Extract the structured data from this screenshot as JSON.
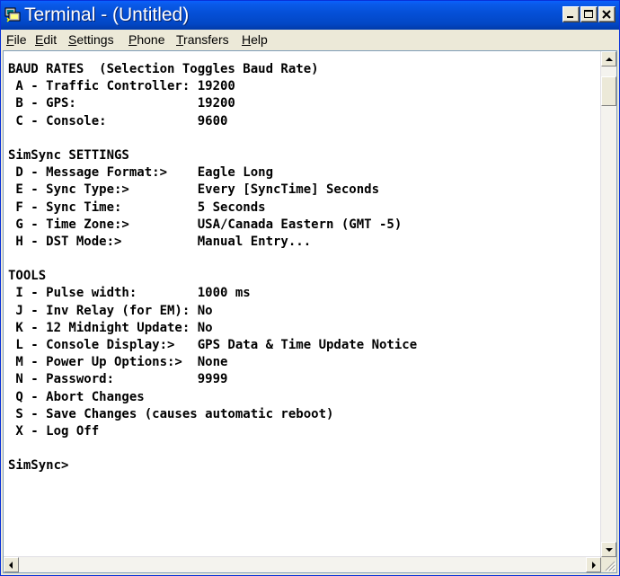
{
  "window": {
    "title": "Terminal - (Untitled)",
    "icon": "terminal-app-icon",
    "controls": [
      "minimize-icon",
      "maximize-icon",
      "close-icon"
    ]
  },
  "menubar": {
    "items": [
      {
        "label": "File",
        "accel": "F",
        "rest": "ile"
      },
      {
        "label": "Edit",
        "accel": "E",
        "rest": "dit"
      },
      {
        "label": "Settings",
        "accel": "S",
        "rest": "ettings"
      },
      {
        "label": "Phone",
        "accel": "P",
        "rest": "hone"
      },
      {
        "label": "Transfers",
        "accel": "T",
        "rest": "ransfers"
      },
      {
        "label": "Help",
        "accel": "H",
        "rest": "elp"
      }
    ]
  },
  "terminal": {
    "lines": [
      "BAUD RATES  (Selection Toggles Baud Rate)",
      " A - Traffic Controller: 19200",
      " B - GPS:                19200",
      " C - Console:            9600",
      "",
      "SimSync SETTINGS",
      " D - Message Format:>    Eagle Long",
      " E - Sync Type:>         Every [SyncTime] Seconds",
      " F - Sync Time:          5 Seconds",
      " G - Time Zone:>         USA/Canada Eastern (GMT -5)",
      " H - DST Mode:>          Manual Entry...",
      "",
      "TOOLS",
      " I - Pulse width:        1000 ms",
      " J - Inv Relay (for EM): No",
      " K - 12 Midnight Update: No",
      " L - Console Display:>   GPS Data & Time Update Notice",
      " M - Power Up Options:>  None",
      " N - Password:           9999",
      " Q - Abort Changes",
      " S - Save Changes (causes automatic reboot)",
      " X - Log Off",
      "",
      "SimSync>"
    ]
  },
  "colors": {
    "titlebar": "#0550d8",
    "window_bg": "#ece9d8",
    "terminal_bg": "#ffffff",
    "terminal_fg": "#000000",
    "close_accent": "#000000"
  }
}
